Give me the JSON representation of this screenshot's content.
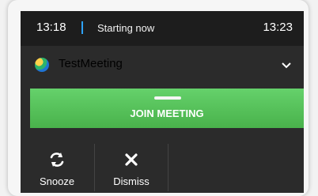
{
  "header": {
    "start_time": "13:18",
    "status": "Starting now",
    "end_time": "13:23"
  },
  "meeting": {
    "title": "TestMeeting"
  },
  "primary_action": {
    "label": "JOIN MEETING"
  },
  "actions": [
    {
      "label": "Snooze",
      "icon": "refresh-icon"
    },
    {
      "label": "Dismiss",
      "icon": "close-icon"
    }
  ],
  "colors": {
    "accent": "#2ea3ff",
    "join_green": "#5ac65f",
    "panel": "#2b2b2b"
  }
}
